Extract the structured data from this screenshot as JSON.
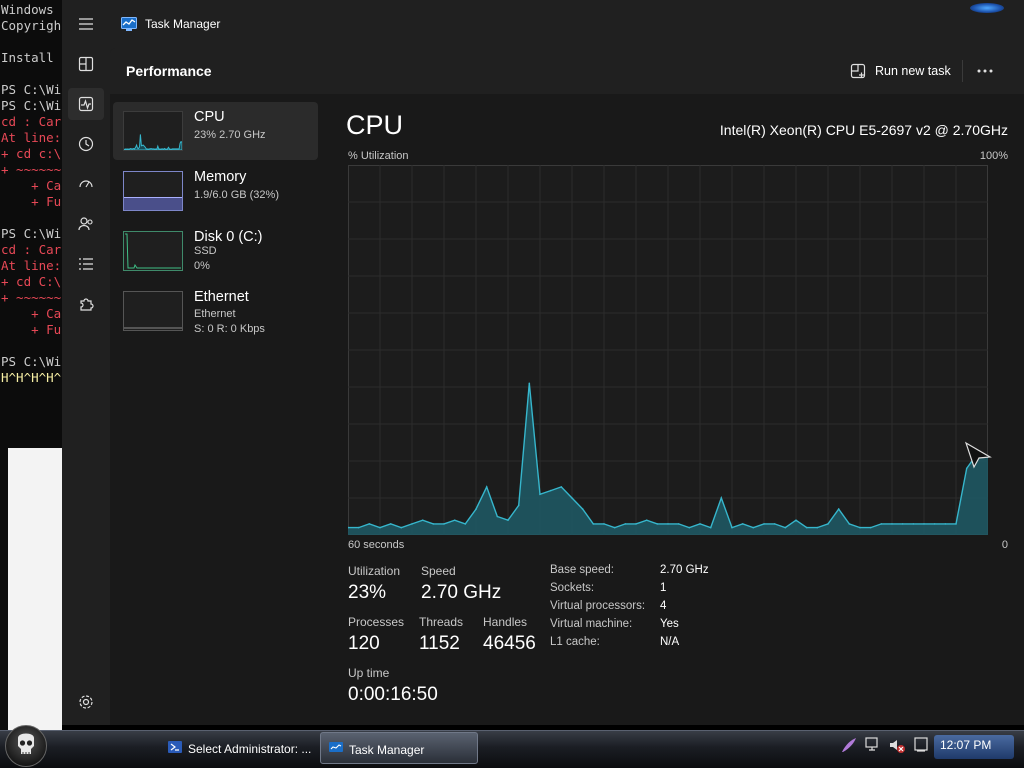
{
  "console": {
    "lines": [
      "Windows",
      "Copyrigh",
      "",
      "Install",
      "",
      "PS C:\\Wi",
      "PS C:\\Wi",
      "cd : Car",
      "At line:",
      "+ cd c:\\",
      "+ ~~~~~~",
      "    + Ca",
      "    + Fu",
      "",
      "PS C:\\Wi",
      "cd : Car",
      "At line:",
      "+ cd C:\\",
      "+ ~~~~~~",
      "    + Ca",
      "    + Fu",
      "",
      "PS C:\\Wi",
      "H^H^H^H^"
    ]
  },
  "window": {
    "title": "Task Manager"
  },
  "nav": {
    "items": [
      "menu",
      "processes",
      "performance",
      "app-history",
      "startup-apps",
      "users",
      "details",
      "services",
      "settings"
    ],
    "active": "performance"
  },
  "header": {
    "title": "Performance",
    "run_new_task": "Run new task"
  },
  "sidebar": {
    "items": [
      {
        "name": "CPU",
        "sub1": "23% 2.70 GHz",
        "sub2": "",
        "sub3": ""
      },
      {
        "name": "Memory",
        "sub1": "1.9/6.0 GB (32%)",
        "sub2": "",
        "sub3": ""
      },
      {
        "name": "Disk 0 (C:)",
        "sub1": "SSD",
        "sub2": "0%",
        "sub3": ""
      },
      {
        "name": "Ethernet",
        "sub1": "Ethernet",
        "sub2": "S: 0 R: 0 Kbps",
        "sub3": ""
      }
    ],
    "memory_usage_fraction": 0.32
  },
  "cpu": {
    "heading": "CPU",
    "model": "Intel(R) Xeon(R) CPU E5-2697 v2 @ 2.70GHz",
    "util_label": "% Utilization",
    "util_max": "100%",
    "graph_time": "60 seconds",
    "graph_min": "0",
    "stats": {
      "utilization_label": "Utilization",
      "utilization": "23%",
      "speed_label": "Speed",
      "speed": "2.70 GHz",
      "processes_label": "Processes",
      "processes": "120",
      "threads_label": "Threads",
      "threads": "1152",
      "handles_label": "Handles",
      "handles": "46456",
      "uptime_label": "Up time",
      "uptime": "0:00:16:50"
    },
    "details": [
      {
        "key": "Base speed:",
        "value": "2.70 GHz"
      },
      {
        "key": "Sockets:",
        "value": "1"
      },
      {
        "key": "Virtual processors:",
        "value": "4"
      },
      {
        "key": "Virtual machine:",
        "value": "Yes"
      },
      {
        "key": "L1 cache:",
        "value": "N/A"
      }
    ]
  },
  "chart_data": {
    "type": "area",
    "title": "",
    "xlabel": "60 seconds",
    "ylabel": "% Utilization",
    "xlim": [
      60,
      0
    ],
    "ylim": [
      0,
      100
    ],
    "grid": true,
    "x": [
      60,
      59,
      58,
      57,
      56,
      55,
      54,
      53,
      52,
      51,
      50,
      49,
      48,
      47,
      46,
      45,
      44,
      43,
      42,
      41,
      40,
      39,
      38,
      37,
      36,
      35,
      34,
      33,
      32,
      31,
      30,
      29,
      28,
      27,
      26,
      25,
      24,
      23,
      22,
      21,
      20,
      19,
      18,
      17,
      16,
      15,
      14,
      13,
      12,
      11,
      10,
      9,
      8,
      7,
      6,
      5,
      4,
      3,
      2,
      1,
      0
    ],
    "series": [
      {
        "values": [
          2,
          2,
          3,
          2,
          3,
          2,
          3,
          4,
          3,
          3,
          4,
          3,
          7,
          13,
          5,
          4,
          8,
          41,
          11,
          12,
          13,
          10,
          7,
          3,
          3,
          2,
          3,
          3,
          4,
          3,
          3,
          3,
          2,
          3,
          2,
          10,
          2,
          3,
          2,
          3,
          3,
          2,
          4,
          2,
          2,
          3,
          7,
          3,
          2,
          2,
          3,
          3,
          3,
          3,
          3,
          3,
          3,
          3,
          18,
          22,
          21
        ]
      }
    ],
    "color": "#2aa0b4"
  },
  "taskbar": {
    "buttons": [
      {
        "label": "Select Administrator: ...",
        "active": false
      },
      {
        "label": "Task Manager",
        "active": true
      }
    ],
    "clock": "12:07 PM"
  }
}
